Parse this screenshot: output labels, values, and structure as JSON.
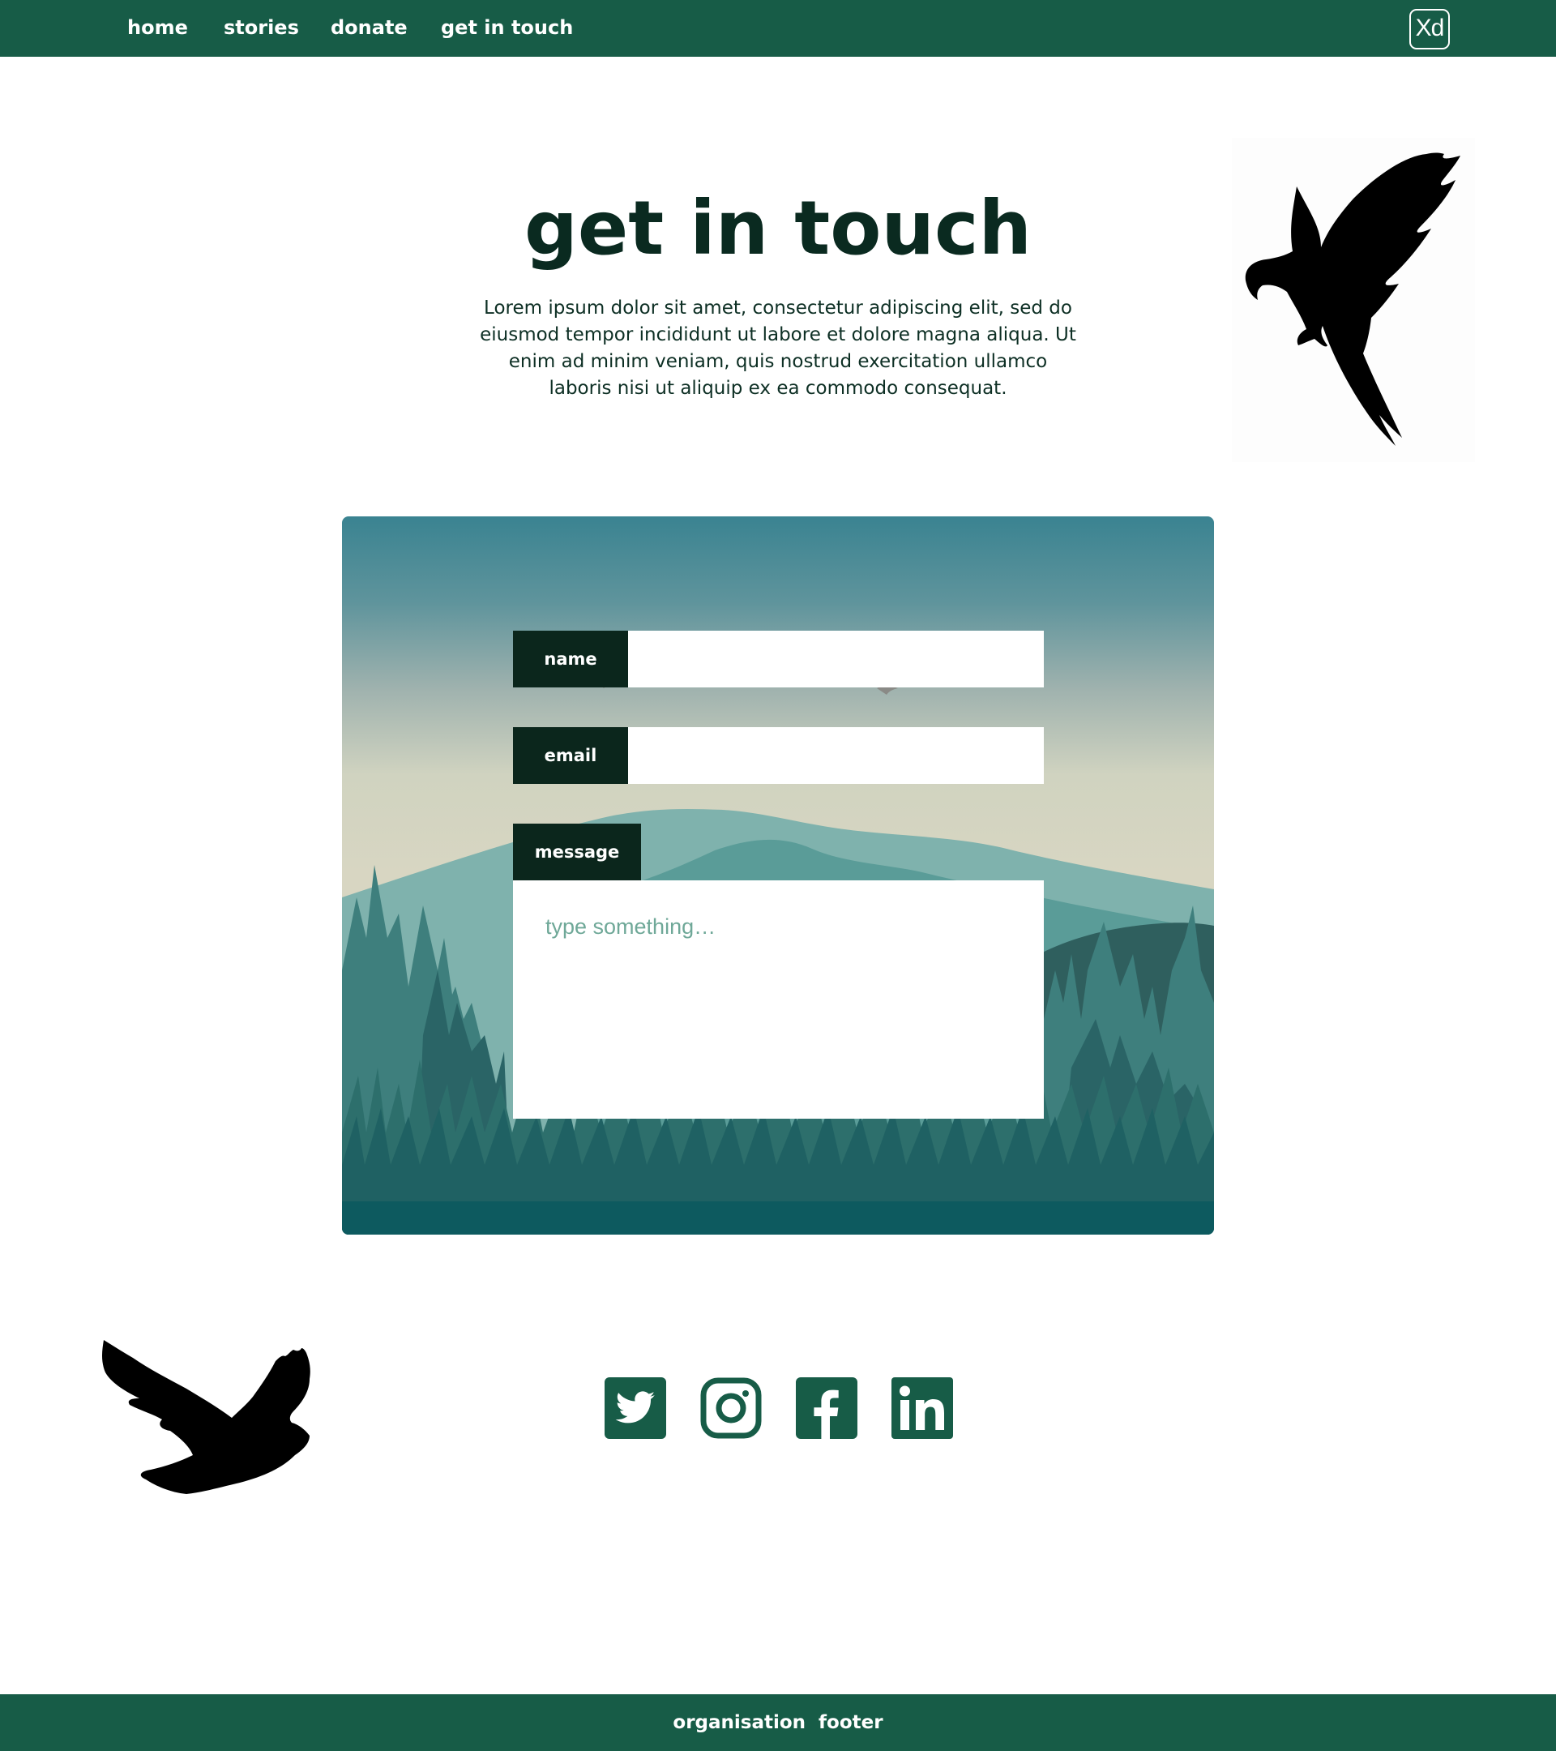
{
  "nav": {
    "items": [
      {
        "label": "home"
      },
      {
        "label": "stories"
      },
      {
        "label": "donate"
      },
      {
        "label": "get in touch"
      }
    ],
    "badge": "Xd"
  },
  "hero": {
    "title": "get in touch",
    "text": "Lorem ipsum dolor sit amet, consectetur adipiscing elit, sed do eiusmod tempor incididunt ut labore et dolore magna aliqua. Ut enim ad minim veniam, quis nostrud exercitation ullamco laboris nisi ut aliquip ex ea commodo consequat."
  },
  "form": {
    "name_label": "name",
    "name_value": "",
    "email_label": "email",
    "email_value": "",
    "message_label": "message",
    "message_placeholder": "type something…",
    "message_value": ""
  },
  "social": [
    {
      "icon": "twitter-icon"
    },
    {
      "icon": "instagram-icon"
    },
    {
      "icon": "facebook-icon"
    },
    {
      "icon": "linkedin-icon"
    }
  ],
  "footer": {
    "text": "organisation  footer"
  },
  "colors": {
    "brand_green": "#175c47",
    "label_dark": "#0b261c",
    "placeholder": "#6fa898",
    "page_bg": "#ffffff"
  }
}
